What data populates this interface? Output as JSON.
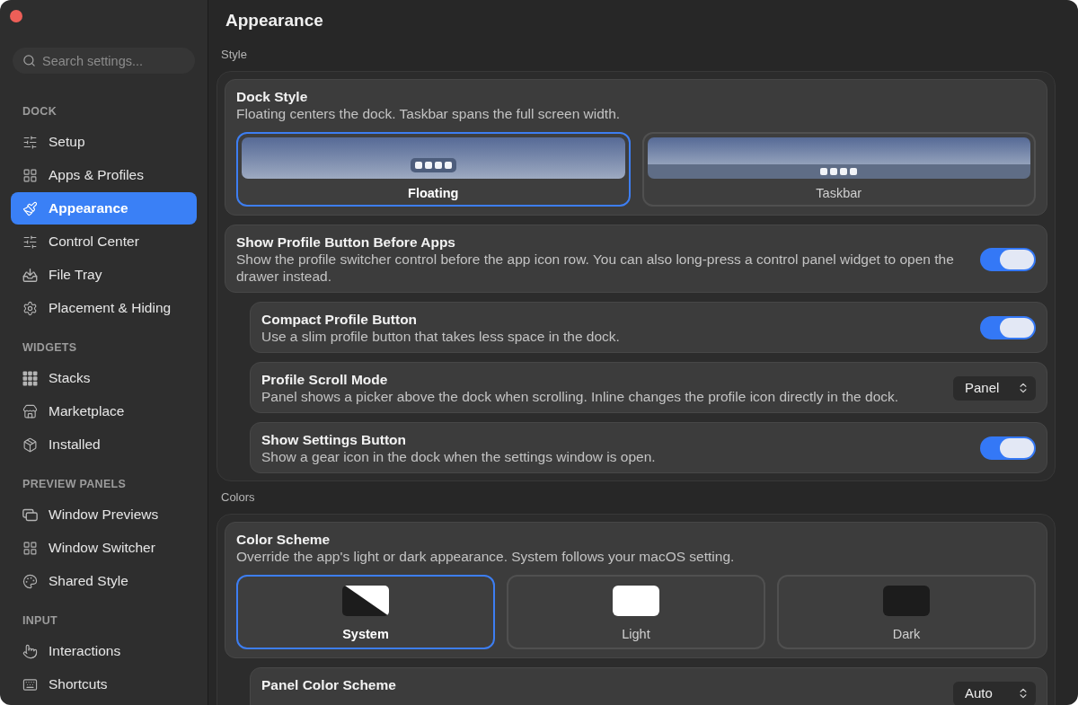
{
  "sidebar": {
    "search": {
      "placeholder": "Search settings..."
    },
    "sections": [
      {
        "title": "DOCK",
        "items": [
          {
            "label": "Setup",
            "selected": false
          },
          {
            "label": "Apps & Profiles",
            "selected": false
          },
          {
            "label": "Appearance",
            "selected": true
          },
          {
            "label": "Control Center",
            "selected": false
          },
          {
            "label": "File Tray",
            "selected": false
          },
          {
            "label": "Placement & Hiding",
            "selected": false
          }
        ]
      },
      {
        "title": "WIDGETS",
        "items": [
          {
            "label": "Stacks",
            "selected": false
          },
          {
            "label": "Marketplace",
            "selected": false
          },
          {
            "label": "Installed",
            "selected": false
          }
        ]
      },
      {
        "title": "PREVIEW PANELS",
        "items": [
          {
            "label": "Window Previews",
            "selected": false
          },
          {
            "label": "Window Switcher",
            "selected": false
          },
          {
            "label": "Shared Style",
            "selected": false
          }
        ]
      },
      {
        "title": "INPUT",
        "items": [
          {
            "label": "Interactions",
            "selected": false
          },
          {
            "label": "Shortcuts",
            "selected": false
          }
        ]
      }
    ]
  },
  "page": {
    "title": "Appearance"
  },
  "groups": [
    {
      "label": "Style",
      "settings": [
        {
          "kind": "choice",
          "title": "Dock Style",
          "description": "Floating centers the dock. Taskbar spans the full screen width.",
          "options": [
            {
              "kind": "floating",
              "label": "Floating",
              "selected": true
            },
            {
              "kind": "taskbar",
              "label": "Taskbar",
              "selected": false
            }
          ]
        },
        {
          "kind": "toggle",
          "title": "Show Profile Button Before Apps",
          "description": "Show the profile switcher control before the app icon row. You can also long-press a control panel widget to open the drawer instead.",
          "on": true,
          "children": [
            {
              "kind": "toggle",
              "title": "Compact Profile Button",
              "description": "Use a slim profile button that takes less space in the dock.",
              "on": true
            },
            {
              "kind": "select",
              "title": "Profile Scroll Mode",
              "description": "Panel shows a picker above the dock when scrolling. Inline changes the profile icon directly in the dock.",
              "value": "Panel"
            },
            {
              "kind": "toggle",
              "title": "Show Settings Button",
              "description": "Show a gear icon in the dock when the settings window is open.",
              "on": true
            }
          ]
        }
      ]
    },
    {
      "label": "Colors",
      "settings": [
        {
          "kind": "choice",
          "title": "Color Scheme",
          "description": "Override the app's light or dark appearance. System follows your macOS setting.",
          "options": [
            {
              "kind": "system",
              "label": "System",
              "selected": true
            },
            {
              "kind": "light",
              "label": "Light",
              "selected": false
            },
            {
              "kind": "dark",
              "label": "Dark",
              "selected": false
            }
          ],
          "children": [
            {
              "kind": "select",
              "title": "Panel Color Scheme",
              "value": "Auto"
            }
          ]
        }
      ]
    }
  ]
}
